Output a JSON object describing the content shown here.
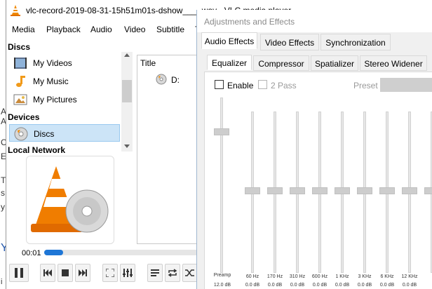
{
  "background": {
    "chars": [
      "A",
      "A",
      "C",
      "E",
      "T",
      "s",
      "y"
    ],
    "link_char": "Y",
    "bottom_char": "i"
  },
  "vlc": {
    "title": "vlc-record-2019-08-31-15h51m01s-dshow___-.wav - VLC media player",
    "menu": [
      "Media",
      "Playback",
      "Audio",
      "Video",
      "Subtitle",
      "T"
    ],
    "sidebar": {
      "discs_header": "Discs",
      "items": [
        {
          "label": "My Videos",
          "icon": "videos-folder-icon"
        },
        {
          "label": "My Music",
          "icon": "music-note-icon"
        },
        {
          "label": "My Pictures",
          "icon": "pictures-icon"
        }
      ],
      "devices_header": "Devices",
      "discs_item": {
        "label": "Discs",
        "icon": "disc-icon"
      },
      "local_network_header": "Local Network"
    },
    "list": {
      "column_title": "Title",
      "row_label": "D:"
    },
    "time": "00:01",
    "progress": 0.12,
    "accent_color": "#1e76d6"
  },
  "dialog": {
    "title": "Adjustments and Effects",
    "tabs": [
      "Audio Effects",
      "Video Effects",
      "Synchronization"
    ],
    "subtabs": [
      "Equalizer",
      "Compressor",
      "Spatializer",
      "Stereo Widener"
    ],
    "enable_label": "Enable",
    "two_pass_label": "2 Pass",
    "preset_label": "Preset",
    "preamp": {
      "label": "Preamp",
      "value": "12.0 dB"
    },
    "bands": [
      {
        "freq": "60 Hz",
        "gain": "0.0 dB"
      },
      {
        "freq": "170 Hz",
        "gain": "0.0 dB"
      },
      {
        "freq": "310 Hz",
        "gain": "0.0 dB"
      },
      {
        "freq": "600 Hz",
        "gain": "0.0 dB"
      },
      {
        "freq": "1 KHz",
        "gain": "0.0 dB"
      },
      {
        "freq": "3 KHz",
        "gain": "0.0 dB"
      },
      {
        "freq": "6 KHz",
        "gain": "0.0 dB"
      },
      {
        "freq": "12 KHz",
        "gain": "0.0 dB"
      },
      {
        "freq": "",
        "gain": ""
      }
    ]
  }
}
